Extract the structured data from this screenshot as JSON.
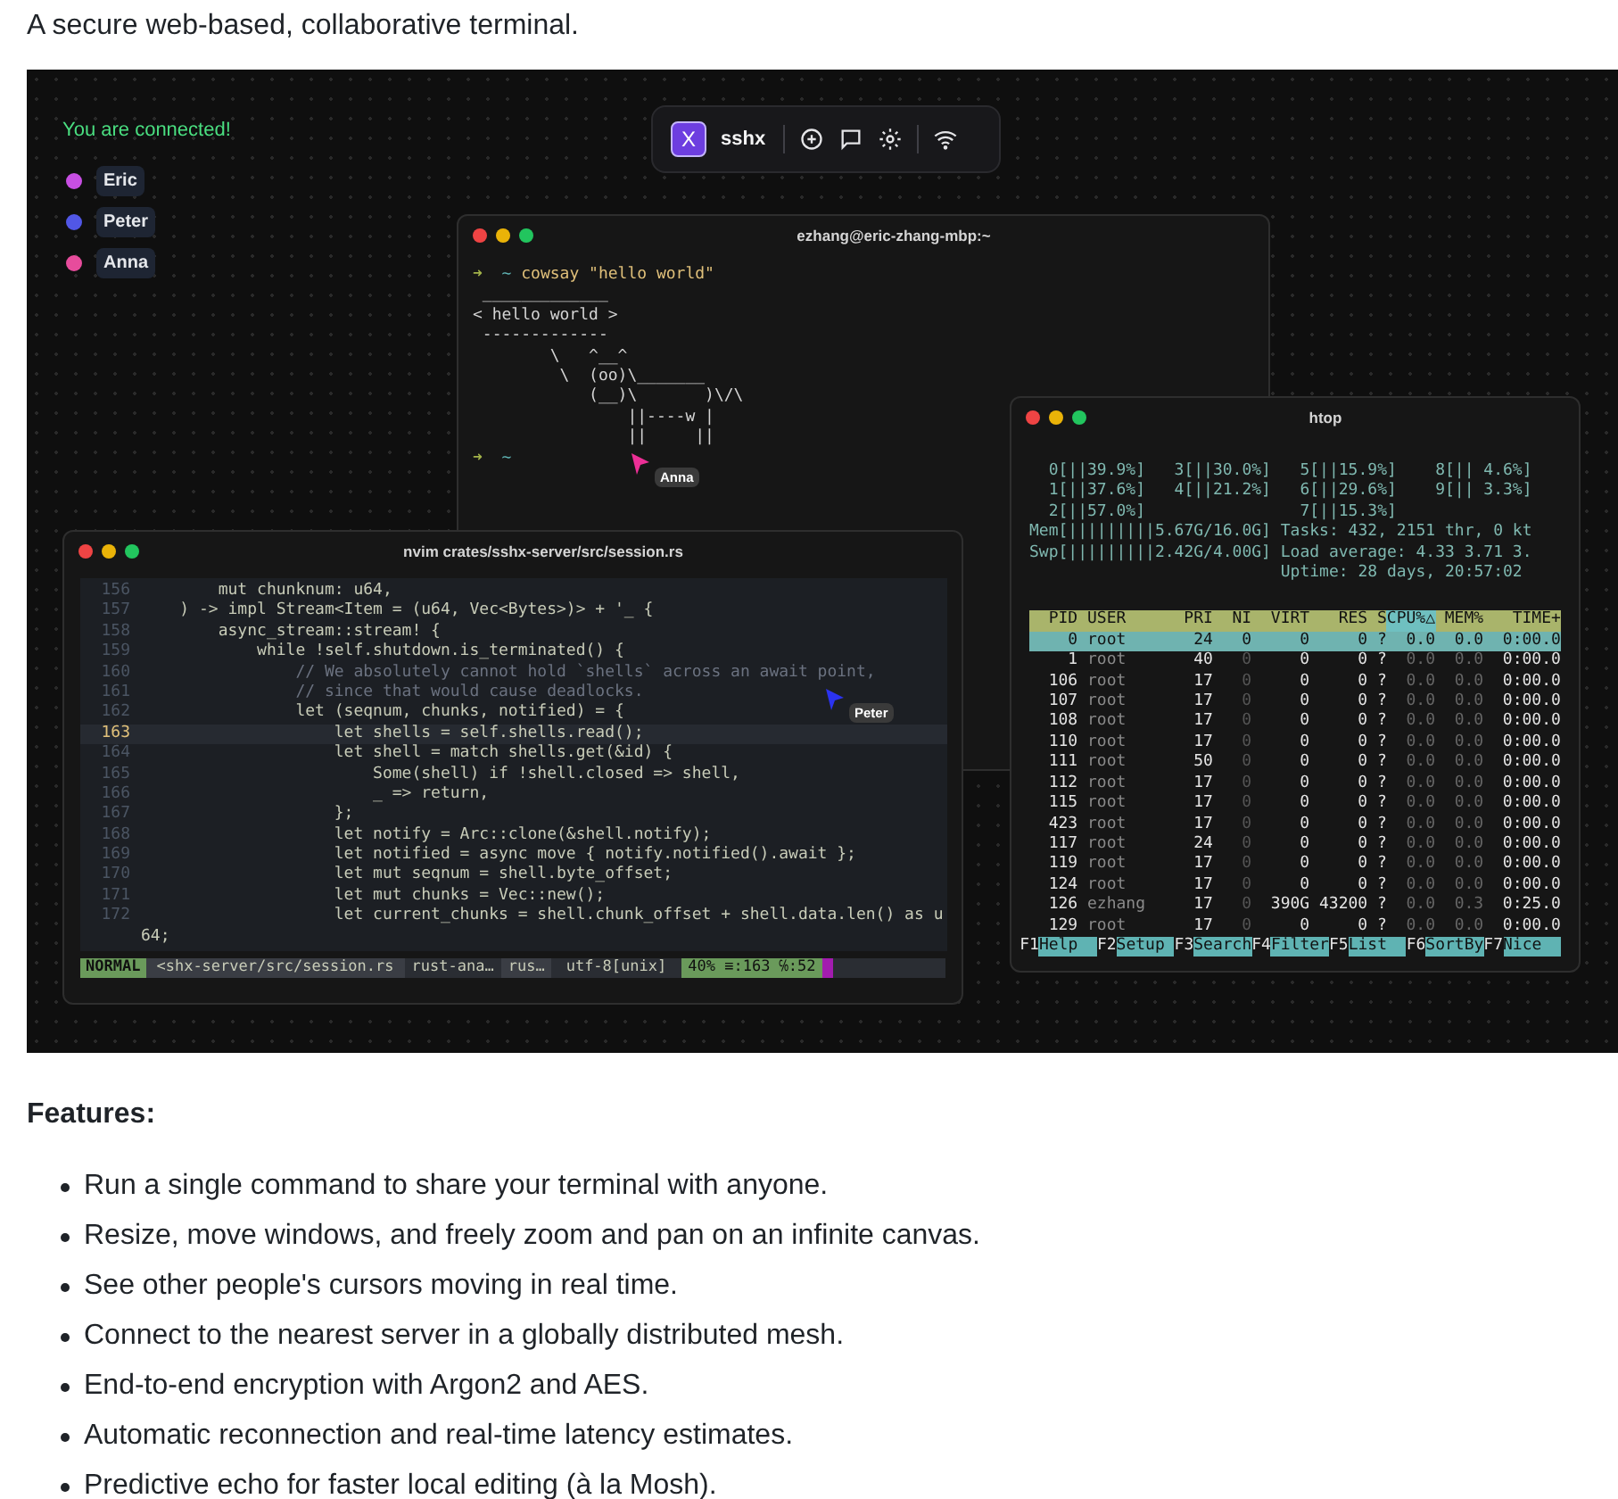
{
  "intro": "A secure web-based, collaborative terminal.",
  "demo": {
    "status": "You are connected!",
    "users": [
      {
        "name": "Eric",
        "color": "#c84fe3"
      },
      {
        "name": "Peter",
        "color": "#5157e6"
      },
      {
        "name": "Anna",
        "color": "#e74c9c"
      }
    ],
    "toolbar": {
      "logo": "X",
      "title": "sshx"
    },
    "cowsay": {
      "title": "ezhang@eric-zhang-mbp:~",
      "lines": [
        {
          "kind": "prompt",
          "arrow": "➜",
          "dir": "~",
          "command": "cowsay \"hello world\""
        },
        {
          "kind": "output",
          "text": " _____________"
        },
        {
          "kind": "output",
          "text": "< hello world >"
        },
        {
          "kind": "output",
          "text": " -------------"
        },
        {
          "kind": "output",
          "text": "        \\   ^__^"
        },
        {
          "kind": "output",
          "text": "         \\  (oo)\\_______"
        },
        {
          "kind": "output",
          "text": "            (__)\\       )\\/\\"
        },
        {
          "kind": "output",
          "text": "                ||----w |"
        },
        {
          "kind": "output",
          "text": "                ||     ||"
        },
        {
          "kind": "prompt",
          "arrow": "➜",
          "dir": "~"
        }
      ]
    },
    "nvim": {
      "title": "nvim crates/sshx-server/src/session.rs",
      "lines": [
        {
          "number": "156",
          "text": "        mut chunknum: u64,",
          "kind": "code",
          "selected": false
        },
        {
          "number": "157",
          "text": "    ) -> impl Stream<Item = (u64, Vec<Bytes>)> + '_ {",
          "kind": "code",
          "selected": false
        },
        {
          "number": "158",
          "text": "        async_stream::stream! {",
          "kind": "code",
          "selected": false
        },
        {
          "number": "159",
          "text": "            while !self.shutdown.is_terminated() {",
          "kind": "code",
          "selected": false
        },
        {
          "number": "160",
          "text": "                // We absolutely cannot hold `shells` across an await point,",
          "kind": "comment",
          "selected": false
        },
        {
          "number": "161",
          "text": "                // since that would cause deadlocks.",
          "kind": "comment",
          "selected": false
        },
        {
          "number": "162",
          "text": "                let (seqnum, chunks, notified) = {",
          "kind": "code",
          "selected": false
        },
        {
          "number": "163",
          "text": "                    let shells = self.shells.read();",
          "kind": "code",
          "selected": true
        },
        {
          "number": "164",
          "text": "                    let shell = match shells.get(&id) {",
          "kind": "code",
          "selected": false
        },
        {
          "number": "165",
          "text": "                        Some(shell) if !shell.closed => shell,",
          "kind": "code",
          "selected": false
        },
        {
          "number": "166",
          "text": "                        _ => return,",
          "kind": "code",
          "selected": false
        },
        {
          "number": "167",
          "text": "                    };",
          "kind": "code",
          "selected": false
        },
        {
          "number": "168",
          "text": "                    let notify = Arc::clone(&shell.notify);",
          "kind": "code",
          "selected": false
        },
        {
          "number": "169",
          "text": "                    let notified = async move { notify.notified().await };",
          "kind": "code",
          "selected": false
        },
        {
          "number": "170",
          "text": "                    let mut seqnum = shell.byte_offset;",
          "kind": "code",
          "selected": false
        },
        {
          "number": "171",
          "text": "                    let mut chunks = Vec::new();",
          "kind": "code",
          "selected": false
        },
        {
          "number": "172",
          "text": "                    let current_chunks = shell.chunk_offset + shell.data.len() as u",
          "kind": "code",
          "selected": false
        },
        {
          "text": "64;",
          "kind": "code",
          "selected": false
        }
      ],
      "statusline": {
        "mode": "NORMAL",
        "file": "<shx-server/src/session.rs",
        "lsp": "rust-ana…",
        "filetype": "rus…",
        "encoding": "utf-8[unix]",
        "position": "40% ≡:163 ℅:52"
      }
    },
    "htop": {
      "title": "htop",
      "meters": [
        "  0[||39.9%]   3[||30.0%]   5[||15.9%]    8[|| 4.6%]",
        "  1[||37.6%]   4[||21.2%]   6[||29.6%]    9[|| 3.3%]",
        "  2[||57.0%]                7[||15.3%]",
        "Mem[|||||||||5.67G/16.0G] Tasks: 432, 2151 thr, 0 kt",
        "Swp[|||||||||2.42G/4.00G] Load average: 4.33 3.71 3.",
        "                          Uptime: 28 days, 20:57:02"
      ],
      "columns": [
        {
          "label": "PID",
          "selected": false
        },
        {
          "label": "USER",
          "selected": false
        },
        {
          "label": "PRI",
          "selected": false
        },
        {
          "label": "NI",
          "selected": false
        },
        {
          "label": "VIRT",
          "selected": false
        },
        {
          "label": "RES",
          "selected": false
        },
        {
          "label": "S",
          "selected": false
        },
        {
          "label": "CPU%△",
          "selected": true
        },
        {
          "label": "MEM%",
          "selected": false
        },
        {
          "label": "TIME+",
          "selected": false
        }
      ],
      "rows": [
        {
          "cells": [
            "0",
            "root",
            "24",
            "0",
            "0",
            "0",
            "?",
            "0.0",
            "0.0",
            "0:00.0"
          ],
          "selected": true
        },
        {
          "cells": [
            "1",
            "root",
            "40",
            "0",
            "0",
            "0",
            "?",
            "0.0",
            "0.0",
            "0:00.0"
          ],
          "selected": false
        },
        {
          "cells": [
            "106",
            "root",
            "17",
            "0",
            "0",
            "0",
            "?",
            "0.0",
            "0.0",
            "0:00.0"
          ],
          "selected": false
        },
        {
          "cells": [
            "107",
            "root",
            "17",
            "0",
            "0",
            "0",
            "?",
            "0.0",
            "0.0",
            "0:00.0"
          ],
          "selected": false
        },
        {
          "cells": [
            "108",
            "root",
            "17",
            "0",
            "0",
            "0",
            "?",
            "0.0",
            "0.0",
            "0:00.0"
          ],
          "selected": false
        },
        {
          "cells": [
            "110",
            "root",
            "17",
            "0",
            "0",
            "0",
            "?",
            "0.0",
            "0.0",
            "0:00.0"
          ],
          "selected": false
        },
        {
          "cells": [
            "111",
            "root",
            "50",
            "0",
            "0",
            "0",
            "?",
            "0.0",
            "0.0",
            "0:00.0"
          ],
          "selected": false
        },
        {
          "cells": [
            "112",
            "root",
            "17",
            "0",
            "0",
            "0",
            "?",
            "0.0",
            "0.0",
            "0:00.0"
          ],
          "selected": false
        },
        {
          "cells": [
            "115",
            "root",
            "17",
            "0",
            "0",
            "0",
            "?",
            "0.0",
            "0.0",
            "0:00.0"
          ],
          "selected": false
        },
        {
          "cells": [
            "423",
            "root",
            "17",
            "0",
            "0",
            "0",
            "?",
            "0.0",
            "0.0",
            "0:00.0"
          ],
          "selected": false
        },
        {
          "cells": [
            "117",
            "root",
            "24",
            "0",
            "0",
            "0",
            "?",
            "0.0",
            "0.0",
            "0:00.0"
          ],
          "selected": false
        },
        {
          "cells": [
            "119",
            "root",
            "17",
            "0",
            "0",
            "0",
            "?",
            "0.0",
            "0.0",
            "0:00.0"
          ],
          "selected": false
        },
        {
          "cells": [
            "124",
            "root",
            "17",
            "0",
            "0",
            "0",
            "?",
            "0.0",
            "0.0",
            "0:00.0"
          ],
          "selected": false
        },
        {
          "cells": [
            "126",
            "ezhang",
            "17",
            "0",
            "390G",
            "43200",
            "?",
            "0.0",
            "0.3",
            "0:25.0"
          ],
          "selected": false
        },
        {
          "cells": [
            "129",
            "root",
            "17",
            "0",
            "0",
            "0",
            "?",
            "0.0",
            "0.0",
            "0:00.0"
          ],
          "selected": false
        }
      ],
      "fkeys": [
        {
          "key": "F1",
          "label": "Help"
        },
        {
          "key": "F2",
          "label": "Setup"
        },
        {
          "key": "F3",
          "label": "Search"
        },
        {
          "key": "F4",
          "label": "Filter"
        },
        {
          "key": "F5",
          "label": "List"
        },
        {
          "key": "F6",
          "label": "SortBy"
        },
        {
          "key": "F7",
          "label": "Nice"
        }
      ]
    },
    "cursors": [
      {
        "name": "Anna",
        "color": "#ec2f96"
      },
      {
        "name": "Peter",
        "color": "#2b33f0"
      }
    ]
  },
  "features_heading": "Features:",
  "features": [
    "Run a single command to share your terminal with anyone.",
    "Resize, move windows, and freely zoom and pan on an infinite canvas.",
    "See other people's cursors moving in real time.",
    "Connect to the nearest server in a globally distributed mesh.",
    "End-to-end encryption with Argon2 and AES.",
    "Automatic reconnection and real-time latency estimates.",
    "Predictive echo for faster local editing (à la Mosh)."
  ]
}
